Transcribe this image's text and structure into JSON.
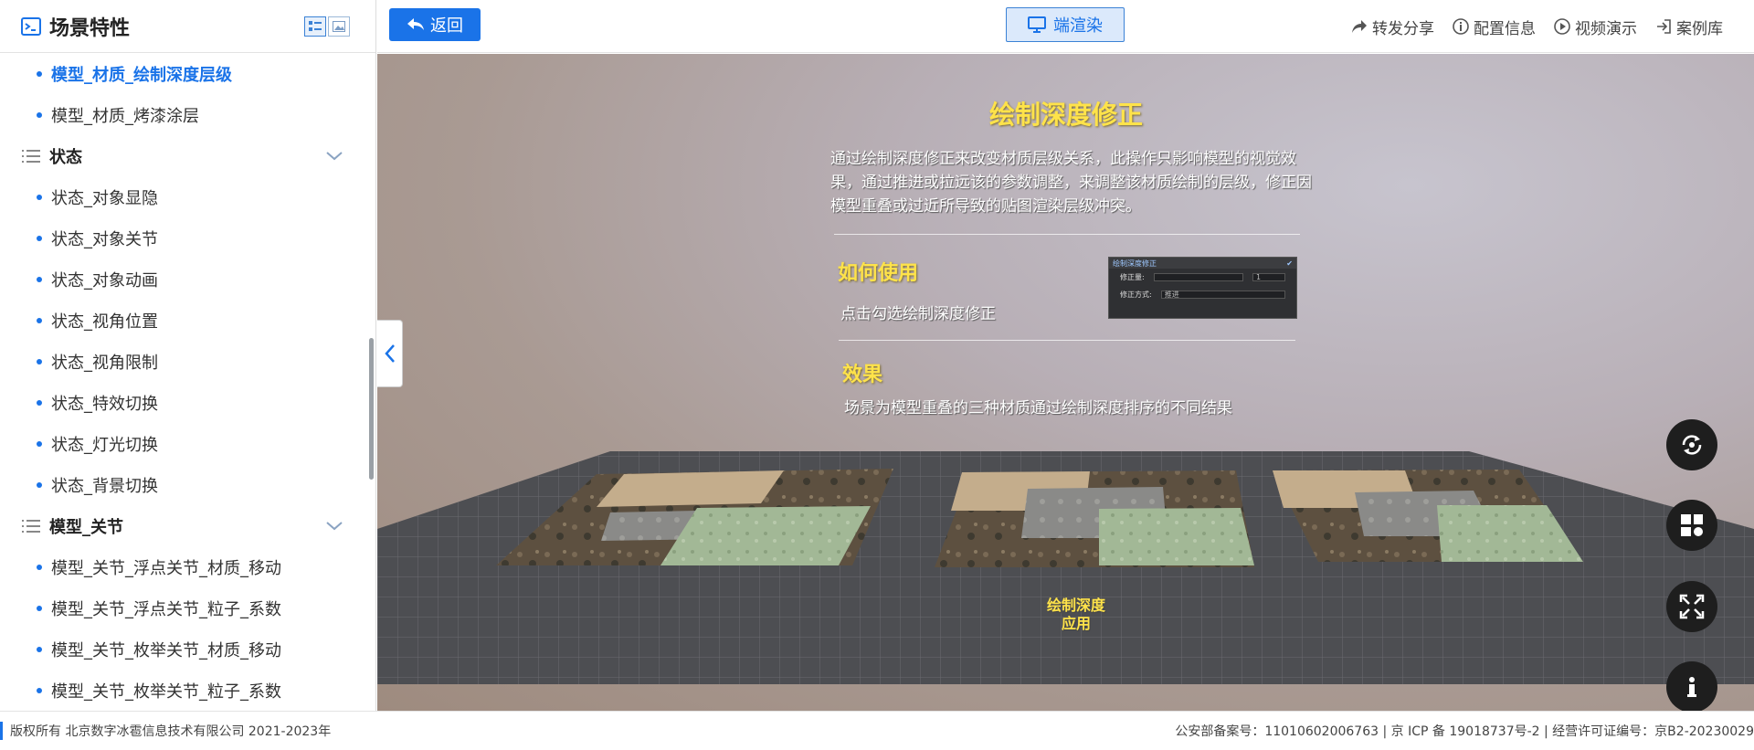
{
  "sidebar": {
    "title": "场景特性",
    "items_top": [
      {
        "label": "模型_材质_绘制深度层级",
        "active": true
      },
      {
        "label": "模型_材质_烤漆涂层",
        "active": false
      }
    ],
    "group1": {
      "label": "状态",
      "items": [
        "状态_对象显隐",
        "状态_对象关节",
        "状态_对象动画",
        "状态_视角位置",
        "状态_视角限制",
        "状态_特效切换",
        "状态_灯光切换",
        "状态_背景切换"
      ]
    },
    "group2": {
      "label": "模型_关节",
      "items": [
        "模型_关节_浮点关节_材质_移动",
        "模型_关节_浮点关节_粒子_系数",
        "模型_关节_枚举关节_材质_移动",
        "模型_关节_枚举关节_粒子_系数"
      ]
    }
  },
  "topbar": {
    "back_label": "返回",
    "render_label": "端渲染",
    "actions": [
      {
        "label": "转发分享",
        "icon": "share-icon"
      },
      {
        "label": "配置信息",
        "icon": "info-circle-icon"
      },
      {
        "label": "视频演示",
        "icon": "play-icon"
      },
      {
        "label": "案例库",
        "icon": "login-icon"
      }
    ]
  },
  "scene": {
    "title": "绘制深度修正",
    "description": "通过绘制深度修正来改变材质层级关系，此操作只影响模型的视觉效果，通过推进或拉远该的参数调整，来调整该材质绘制的层级，修正因模型重叠或过近所导致的贴图渲染层级冲突。",
    "how_title": "如何使用",
    "how_text": "点击勾选绘制深度修正",
    "effect_title": "效果",
    "effect_text": "场景为模型重叠的三种材质通过绘制深度排序的不同结果",
    "mini_panel": {
      "header": "绘制深度修正",
      "row1_label": "修正量:",
      "row1_value": "1",
      "row2_label": "修正方式:",
      "row2_value": "推进"
    },
    "floor_label_line1": "绘制深度",
    "floor_label_line2": "应用"
  },
  "footer": {
    "copyright": "版权所有 北京数字冰雹信息技术有限公司 2021-2023年",
    "record": "公安部备案号：11010602006763 | 京 ICP 备 19018737号-2 | 经营许可证编号：京B2-20230029"
  },
  "colors": {
    "accent": "#1a73e8",
    "highlight_text": "#ffe34a"
  }
}
